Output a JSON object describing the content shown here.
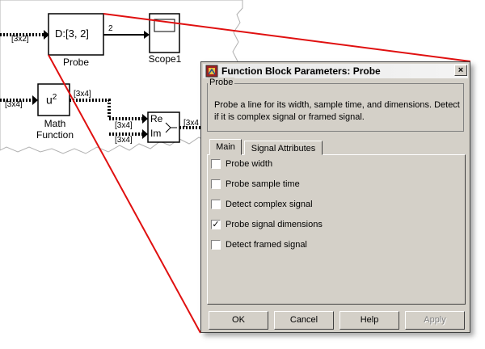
{
  "diagram": {
    "probe_block": {
      "text": "D:[3, 2]",
      "label": "Probe"
    },
    "scope_block": {
      "label": "Scope1"
    },
    "math_block": {
      "text": "u",
      "sup": "2",
      "label_line1": "Math",
      "label_line2": "Function"
    },
    "reim_block": {
      "re": "Re",
      "im": "Im"
    },
    "signals": {
      "probe_in": "[3x2]",
      "probe_out": "2",
      "math_in": "[3x4]",
      "math_out": "[3x4]",
      "reim_in1": "[3x4]",
      "reim_in2": "[3x4]",
      "reim_out": "[3x4"
    }
  },
  "dialog": {
    "title": "Function Block Parameters: Probe",
    "close_label": "×",
    "group_title": "Probe",
    "description": "Probe a line for its width, sample time, and dimensions. Detect if it is complex signal or framed signal.",
    "tabs": [
      {
        "label": "Main"
      },
      {
        "label": "Signal Attributes"
      }
    ],
    "options": [
      {
        "label": "Probe width",
        "checked": false
      },
      {
        "label": "Probe sample time",
        "checked": false
      },
      {
        "label": "Detect complex signal",
        "checked": false
      },
      {
        "label": "Probe signal dimensions",
        "checked": true
      },
      {
        "label": "Detect framed signal",
        "checked": false
      }
    ],
    "buttons": {
      "ok": "OK",
      "cancel": "Cancel",
      "help": "Help",
      "apply": "Apply"
    },
    "check_glyph": "✓"
  }
}
